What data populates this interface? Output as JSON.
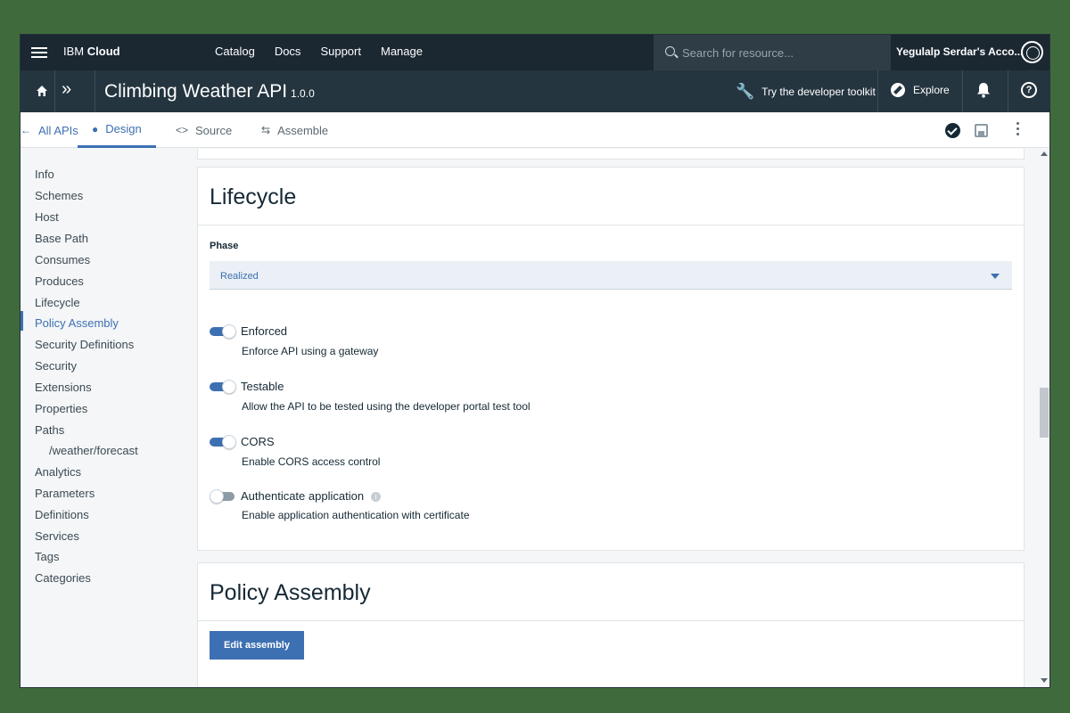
{
  "topnav": {
    "brand_prefix": "IBM",
    "brand_bold": "Cloud",
    "links": [
      "Catalog",
      "Docs",
      "Support",
      "Manage"
    ],
    "search_placeholder": "Search for resource...",
    "account": "Yegulalp Serdar's Acco..."
  },
  "apibar": {
    "title": "Climbing Weather API",
    "version": "1.0.0",
    "toolkit": "Try the developer toolkit",
    "explore": "Explore"
  },
  "tabs": {
    "back": "All APIs",
    "design": "Design",
    "source": "Source",
    "assemble": "Assemble",
    "active": "Design"
  },
  "sidebar": {
    "items": [
      "Info",
      "Schemes",
      "Host",
      "Base Path",
      "Consumes",
      "Produces",
      "Lifecycle",
      "Policy Assembly",
      "Security Definitions",
      "Security",
      "Extensions",
      "Properties",
      "Paths",
      "/weather/forecast",
      "Analytics",
      "Parameters",
      "Definitions",
      "Services",
      "Tags",
      "Categories"
    ],
    "active": "Policy Assembly"
  },
  "lifecycle": {
    "title": "Lifecycle",
    "phase_label": "Phase",
    "phase_value": "Realized",
    "toggles": [
      {
        "label": "Enforced",
        "description": "Enforce API using a gateway",
        "on": true
      },
      {
        "label": "Testable",
        "description": "Allow the API to be tested using the developer portal test tool",
        "on": true
      },
      {
        "label": "CORS",
        "description": "Enable CORS access control",
        "on": true
      },
      {
        "label": "Authenticate application",
        "description": "Enable application authentication with certificate",
        "on": false
      }
    ]
  },
  "policy_assembly": {
    "title": "Policy Assembly",
    "button": "Edit assembly"
  },
  "colors": {
    "accent": "#3d70b2",
    "nav_bg": "#1b2832",
    "bar_bg": "#253540",
    "outer_bg": "#3f6b3c"
  }
}
